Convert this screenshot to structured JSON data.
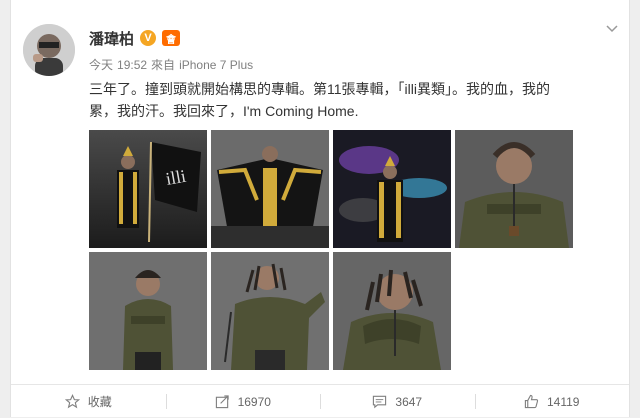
{
  "user": {
    "name": "潘瑋柏",
    "verified_badge": "V",
    "member_badge": "會"
  },
  "meta": {
    "day": "今天",
    "time": "19:52",
    "source_prefix": "來自",
    "device": "iPhone 7 Plus"
  },
  "post": {
    "line1": "三年了。撞到頭就開始構思的專輯。第11張專輯，「illi異類」。我的血，我的",
    "line2": "累，我的汗。我回來了，I'm Coming Home."
  },
  "photos": [
    {
      "icon": "photo-flag-icon"
    },
    {
      "icon": "photo-cape-icon"
    },
    {
      "icon": "photo-galaxy-icon"
    },
    {
      "icon": "photo-hoodie-icon"
    },
    {
      "icon": "photo-hoodie-icon"
    },
    {
      "icon": "photo-dreadlocks-icon"
    },
    {
      "icon": "photo-portrait-icon"
    }
  ],
  "actions": {
    "favorite_label": "收藏",
    "repost_count": "16970",
    "comment_count": "3647",
    "like_count": "14119"
  },
  "colors": {
    "accent": "#ff8200",
    "verified": "#f5a623",
    "text": "#333333",
    "meta": "#808080"
  }
}
